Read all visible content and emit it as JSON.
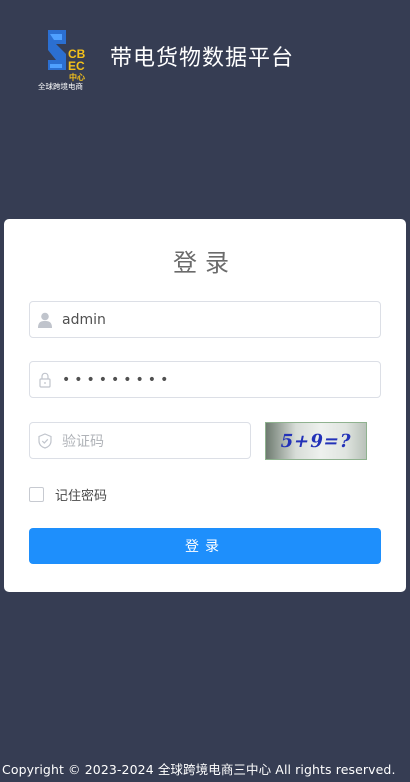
{
  "header": {
    "logo_text": "CBEC中心",
    "logo_subtext": "全球跨境电商",
    "title": "带电货物数据平台"
  },
  "login": {
    "title": "登录",
    "username": {
      "value": "admin",
      "icon": "user-icon"
    },
    "password": {
      "masked_value": "•••••••••",
      "icon": "lock-icon"
    },
    "captcha": {
      "placeholder": "验证码",
      "image_text": "5+9=?",
      "icon": "shield-check-icon"
    },
    "remember_label": "记住密码",
    "submit_label": "登录"
  },
  "footer": {
    "copyright": "Copyright © 2023-2024 全球跨境电商三中心 All rights reserved."
  },
  "colors": {
    "background": "#363d53",
    "primary": "#1e8ffc",
    "card": "#ffffff"
  }
}
